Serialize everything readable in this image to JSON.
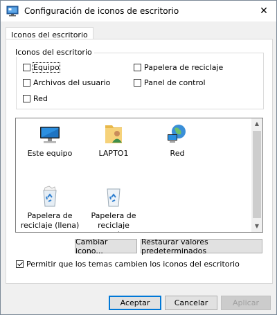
{
  "window": {
    "title": "Configuración de iconos de escritorio",
    "close_glyph": "✕"
  },
  "tab": {
    "label": "Iconos del escritorio"
  },
  "group": {
    "label": "Iconos del escritorio",
    "checkboxes": [
      {
        "label": "Equipo",
        "checked": false
      },
      {
        "label": "Papelera de reciclaje",
        "checked": false
      },
      {
        "label": "Archivos del usuario",
        "checked": false
      },
      {
        "label": "Panel de control",
        "checked": false
      },
      {
        "label": "Red",
        "checked": false
      }
    ]
  },
  "icons": [
    {
      "label": "Este equipo",
      "icon": "computer-icon"
    },
    {
      "label": "LAPTO1",
      "icon": "user-folder-icon"
    },
    {
      "label": "Red",
      "icon": "network-icon"
    },
    {
      "label": "Papelera de reciclaje (llena)",
      "label_line1": "Papelera de",
      "label_line2": "reciclaje (llena)",
      "icon": "recycle-bin-full-icon"
    },
    {
      "label": "Papelera de reciclaje (vacía)",
      "label_line1": "Papelera de",
      "label_line2": "reciclaje (vacía)",
      "icon": "recycle-bin-empty-icon"
    }
  ],
  "buttons": {
    "change_icon": "Cambiar icono...",
    "restore_defaults": "Restaurar valores predeterminados"
  },
  "themes_checkbox": {
    "label": "Permitir que los temas cambien los iconos del escritorio",
    "checked": true
  },
  "footer": {
    "accept": "Aceptar",
    "cancel": "Cancelar",
    "apply": "Aplicar"
  },
  "colors": {
    "accent": "#0078d7"
  }
}
